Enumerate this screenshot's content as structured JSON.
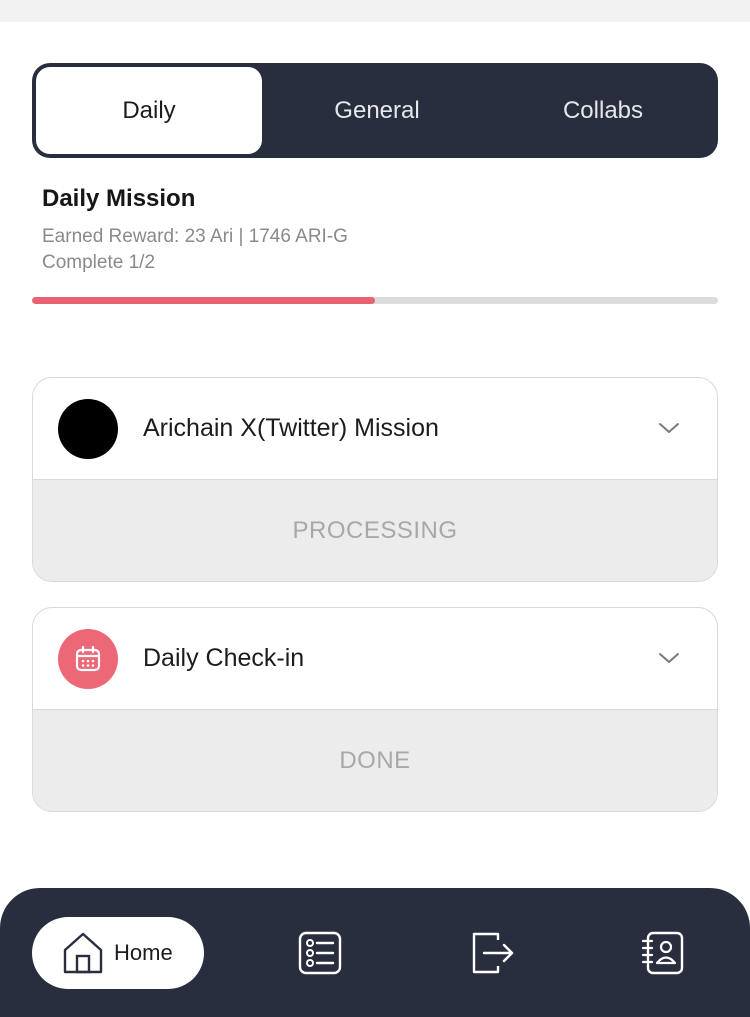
{
  "tabs": [
    {
      "label": "Daily",
      "active": true
    },
    {
      "label": "General",
      "active": false
    },
    {
      "label": "Collabs",
      "active": false
    }
  ],
  "mission": {
    "title": "Daily Mission",
    "reward_text": "Earned Reward: 23 Ari | 1746 ARI-G",
    "complete_text": "Complete 1/2",
    "progress_fraction": 0.5,
    "progress_color": "#e86173"
  },
  "cards": [
    {
      "name": "Arichain X(Twitter) Mission",
      "status": "PROCESSING",
      "icon": "x-twitter-avatar-icon"
    },
    {
      "name": "Daily Check-in",
      "status": "DONE",
      "icon": "calendar-icon"
    }
  ],
  "nav": {
    "home_label": "Home",
    "items": [
      "home-icon",
      "list-icon",
      "logout-icon",
      "contacts-icon"
    ]
  },
  "colors": {
    "dark": "#292e3f",
    "accent": "#e86173"
  }
}
